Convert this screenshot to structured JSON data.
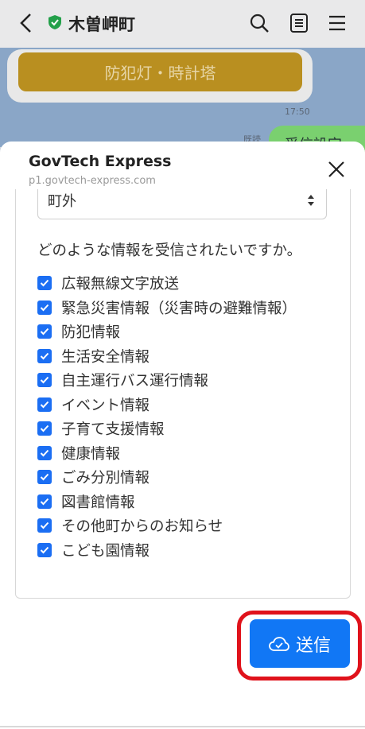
{
  "app": {
    "title": "木曽岬町",
    "bubble_button": "防犯灯・時計塔",
    "time": "17:50",
    "read_label": "既読",
    "green_bubble": "受信設定"
  },
  "sheet": {
    "title": "GovTech Express",
    "url": "p1.govtech-express.com"
  },
  "form": {
    "select_value": "町外",
    "question": "どのような情報を受信されたいですか。",
    "options": [
      {
        "label": "広報無線文字放送",
        "checked": true
      },
      {
        "label": "緊急災害情報（災害時の避難情報）",
        "checked": true
      },
      {
        "label": "防犯情報",
        "checked": true
      },
      {
        "label": "生活安全情報",
        "checked": true
      },
      {
        "label": "自主運行バス運行情報",
        "checked": true
      },
      {
        "label": "イベント情報",
        "checked": true
      },
      {
        "label": "子育て支援情報",
        "checked": true
      },
      {
        "label": "健康情報",
        "checked": true
      },
      {
        "label": "ごみ分別情報",
        "checked": true
      },
      {
        "label": "図書館情報",
        "checked": true
      },
      {
        "label": "その他町からのお知らせ",
        "checked": true
      },
      {
        "label": "こども園情報",
        "checked": true
      }
    ],
    "submit_label": "送信"
  },
  "colors": {
    "accent": "#1177f5",
    "checkbox": "#1b6ef3",
    "highlight": "#e0121b",
    "shield": "#23a04a"
  }
}
